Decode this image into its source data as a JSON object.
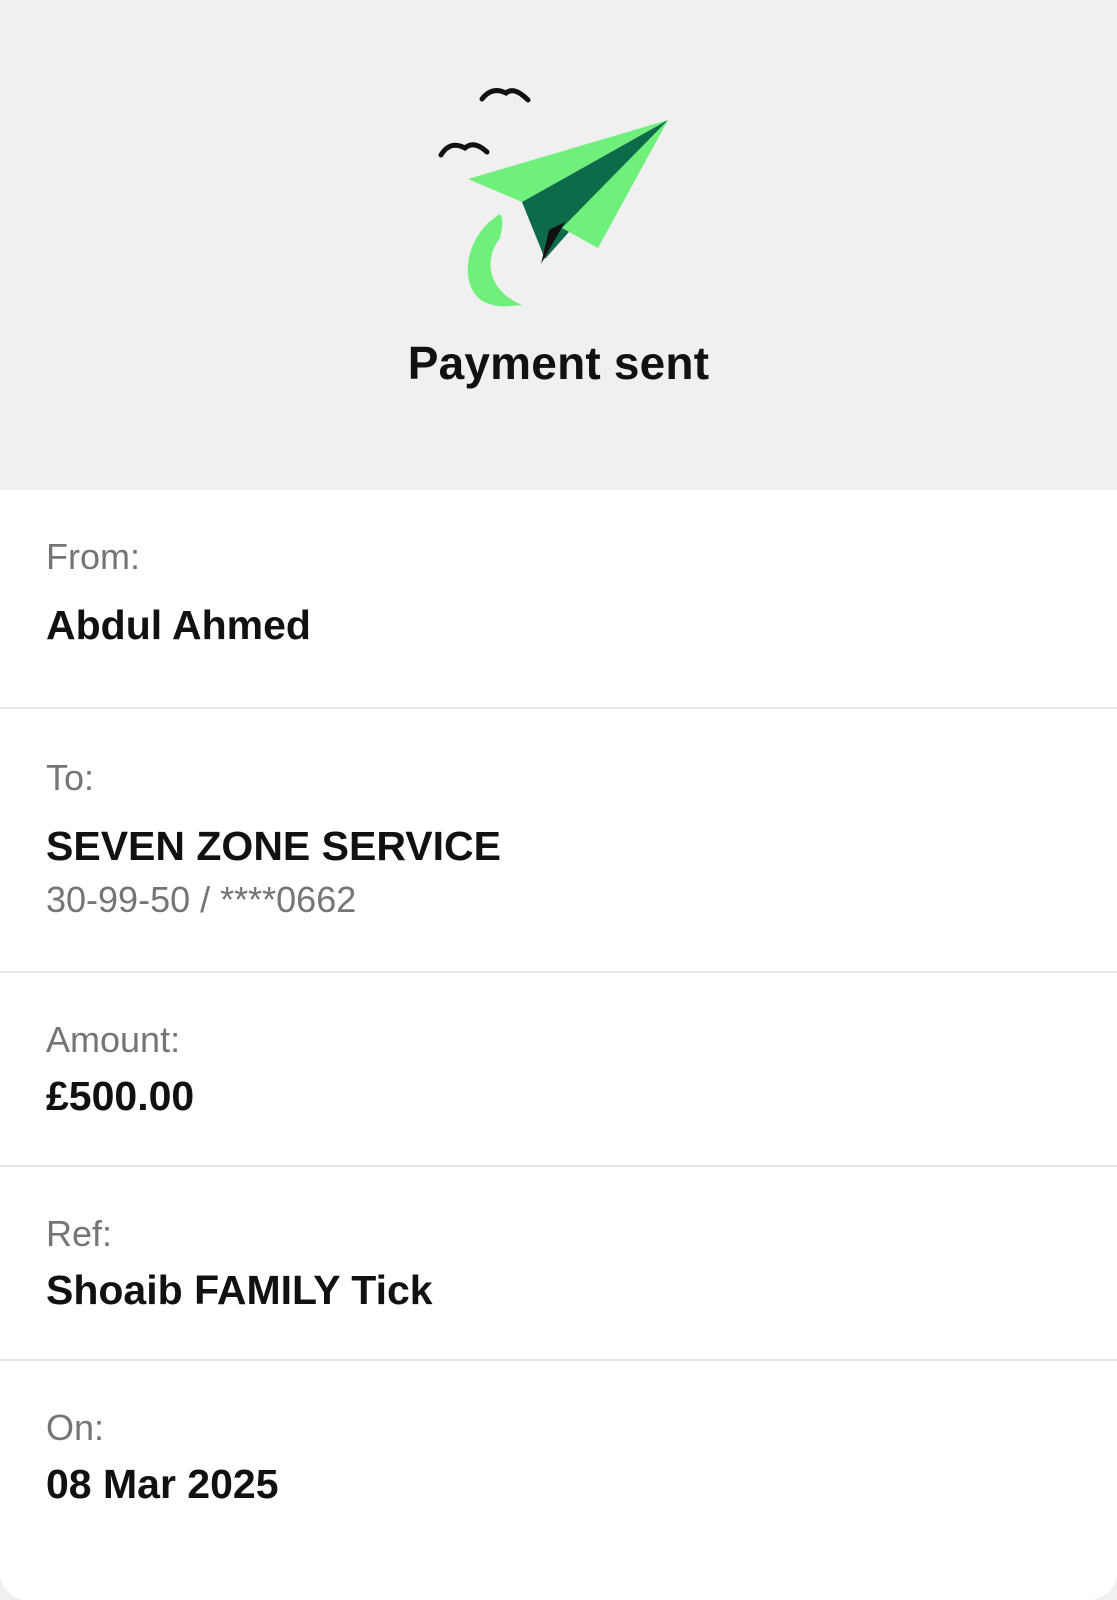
{
  "header": {
    "title": "Payment sent",
    "illustration_icon": "paper-plane-icon",
    "background_color": "#f0f0f0"
  },
  "details": {
    "from": {
      "label": "From:",
      "value": "Abdul Ahmed"
    },
    "to": {
      "label": "To:",
      "value": "SEVEN ZONE SERVICE",
      "account": "30-99-50 / ****0662"
    },
    "amount": {
      "label": "Amount:",
      "value": "£500.00"
    },
    "ref": {
      "label": "Ref:",
      "value": "Shoaib FAMILY Tick"
    },
    "on": {
      "label": "On:",
      "value": "08 Mar 2025"
    }
  },
  "colors": {
    "accent_green": "#6ef07a",
    "dark_green": "#0d6b4a",
    "text_primary": "#111111",
    "text_secondary": "#757575",
    "divider": "#e6e6e6"
  }
}
